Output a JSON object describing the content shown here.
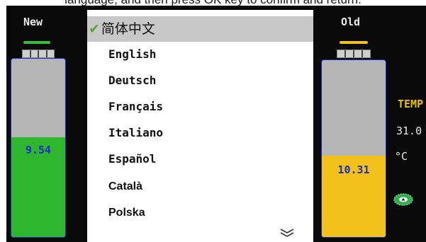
{
  "caption": "language, and then press OK key to confirm and return.",
  "new_panel": {
    "label": "New",
    "value": "9.54",
    "fill_fraction": 0.56,
    "fill_color": "#2fb62f",
    "underline_color": "#33c233"
  },
  "old_panel": {
    "label": "Old",
    "value": "10.31",
    "fill_fraction": 0.46,
    "fill_color": "#f2c21a",
    "underline_color": "#f2c21a"
  },
  "menu": {
    "items": [
      {
        "label": "简体中文",
        "selected": true,
        "check_icon": "checkmark-icon"
      },
      {
        "label": "English"
      },
      {
        "label": "Deutsch"
      },
      {
        "label": "Français"
      },
      {
        "label": "Italiano"
      },
      {
        "label": "Español"
      },
      {
        "label": "Català"
      },
      {
        "label": "Polska"
      }
    ],
    "more_icon": "double-chevron-down-icon"
  },
  "temperature": {
    "label": "TEMP",
    "value": "31.0",
    "unit": "°C"
  },
  "status_icon": "gear-icon"
}
